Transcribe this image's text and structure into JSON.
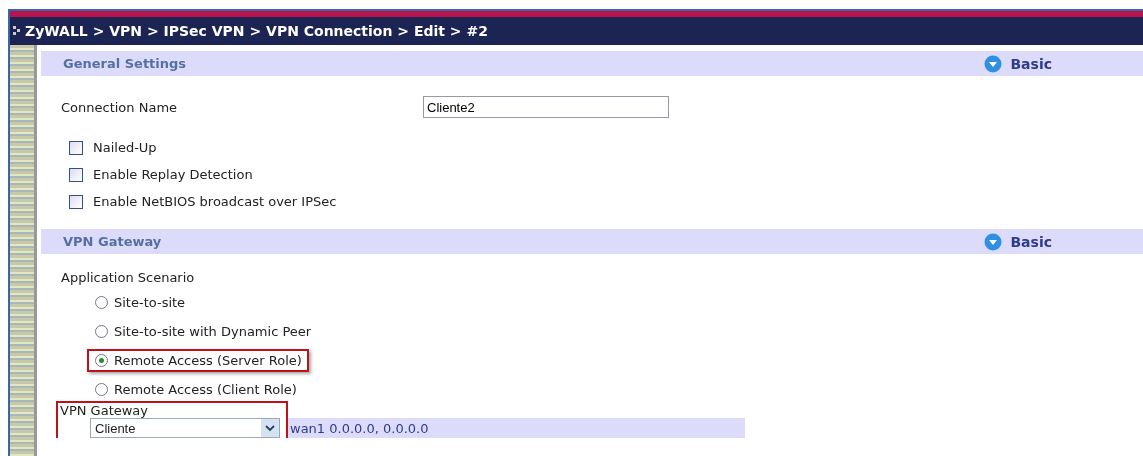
{
  "breadcrumb": "ZyWALL > VPN > IPSec VPN > VPN Connection > Edit > #2",
  "general": {
    "title": "General Settings",
    "mode": "Basic",
    "connection_name": {
      "label": "Connection Name",
      "value": "Cliente2"
    },
    "checkboxes": [
      {
        "label": "Nailed-Up",
        "checked": false
      },
      {
        "label": "Enable Replay Detection",
        "checked": false
      },
      {
        "label": "Enable NetBIOS broadcast over IPSec",
        "checked": false
      }
    ]
  },
  "gateway": {
    "title": "VPN Gateway",
    "mode": "Basic",
    "scenario_label": "Application Scenario",
    "scenarios": [
      {
        "label": "Site-to-site",
        "selected": false,
        "highlighted": false
      },
      {
        "label": "Site-to-site with Dynamic Peer",
        "selected": false,
        "highlighted": false
      },
      {
        "label": "Remote Access (Server Role)",
        "selected": true,
        "highlighted": true
      },
      {
        "label": "Remote Access (Client Role)",
        "selected": false,
        "highlighted": false
      }
    ],
    "vpn_gateway": {
      "label": "VPN Gateway",
      "value": "Cliente",
      "info": "wan1  0.0.0.0, 0.0.0.0",
      "highlighted": true
    }
  }
}
